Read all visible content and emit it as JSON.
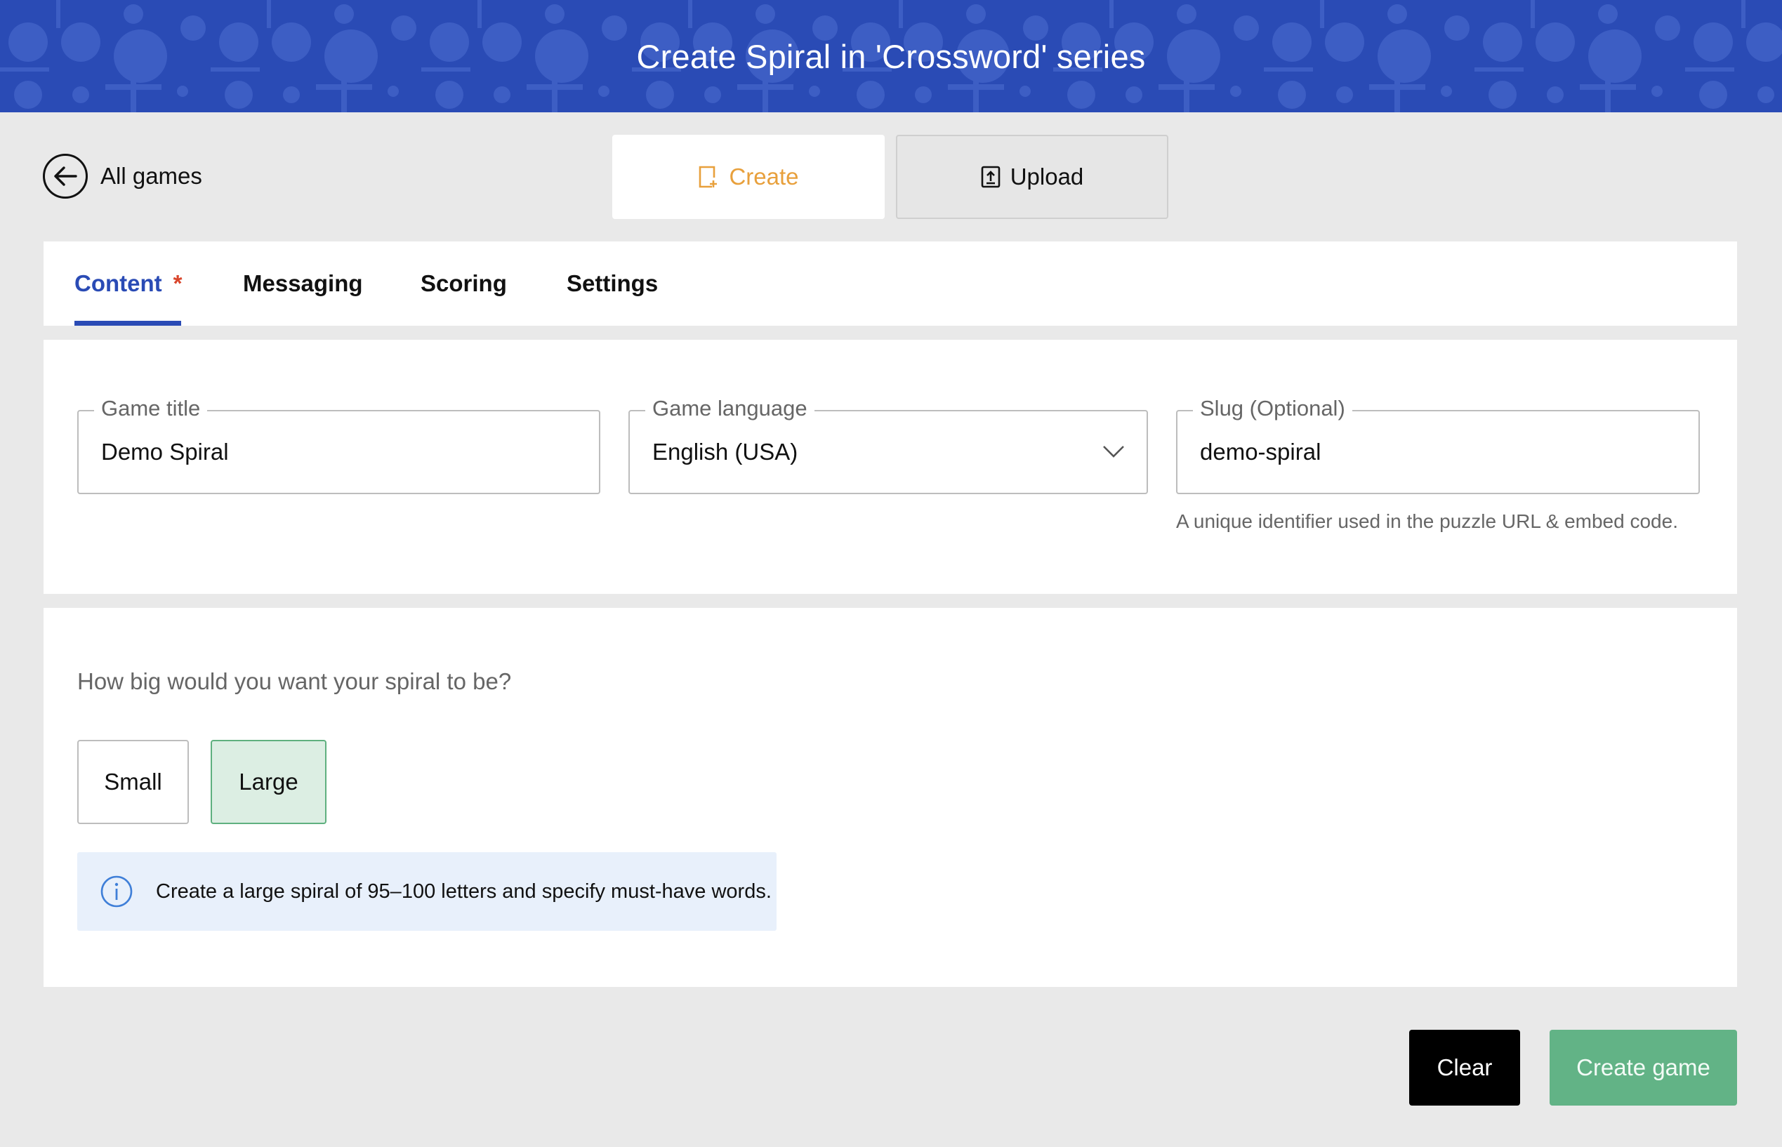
{
  "header": {
    "title": "Create Spiral in 'Crossword' series"
  },
  "nav": {
    "back_label": "All games",
    "modes": {
      "create": "Create",
      "upload": "Upload"
    }
  },
  "tabs": [
    {
      "label": "Content",
      "required_mark": "*",
      "active": true
    },
    {
      "label": "Messaging"
    },
    {
      "label": "Scoring"
    },
    {
      "label": "Settings"
    }
  ],
  "fields": {
    "title": {
      "label": "Game title",
      "value": "Demo Spiral"
    },
    "language": {
      "label": "Game language",
      "value": "English (USA)"
    },
    "slug": {
      "label": "Slug (Optional)",
      "value": "demo-spiral",
      "helper": "A unique identifier used in the puzzle URL & embed code."
    }
  },
  "size": {
    "question": "How big would you want your spiral to be?",
    "options": [
      "Small",
      "Large"
    ],
    "selected": "Large",
    "info": "Create a large spiral of 95–100 letters and specify must-have words."
  },
  "actions": {
    "clear": "Clear",
    "create": "Create game"
  },
  "colors": {
    "brand_blue": "#2a4bb5",
    "create_accent": "#e8a03c",
    "selected_green": "#dceee3",
    "create_game_green": "#62b386",
    "required_red": "#d9452b"
  }
}
